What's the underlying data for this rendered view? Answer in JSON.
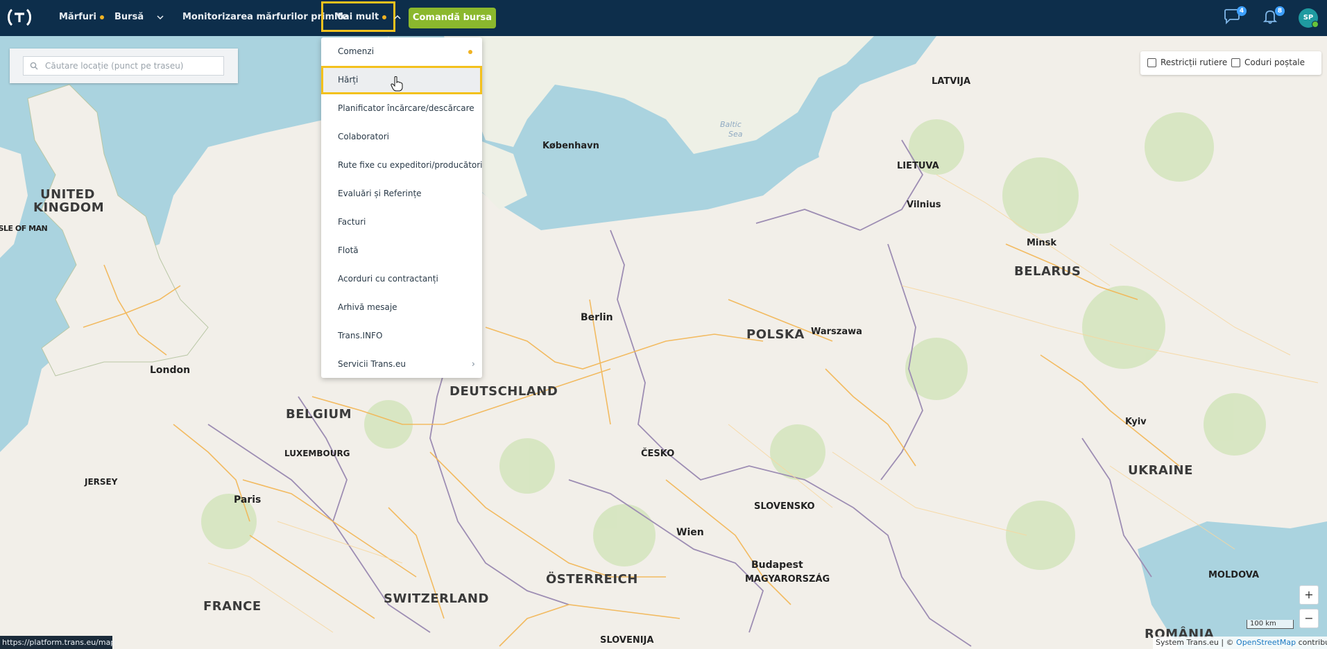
{
  "nav": {
    "items": [
      {
        "label": "Mărfuri"
      },
      {
        "label": "Bursă"
      },
      {
        "label": "Monitorizarea mărfurilor primite"
      },
      {
        "label": "Mai mult"
      }
    ],
    "command_button": "Comandă bursa",
    "messages_count": "4",
    "notifications_count": "8",
    "avatar_initials": "SP"
  },
  "search": {
    "placeholder": "Căutare locație (punct pe traseu)"
  },
  "dropdown": {
    "items": [
      {
        "label": "Comenzi"
      },
      {
        "label": "Hărți"
      },
      {
        "label": "Planificator încărcare/descărcare"
      },
      {
        "label": "Colaboratori"
      },
      {
        "label": "Rute fixe cu expeditori/producători"
      },
      {
        "label": "Evaluări și Referințe"
      },
      {
        "label": "Facturi"
      },
      {
        "label": "Flotă"
      },
      {
        "label": "Acorduri cu contractanți"
      },
      {
        "label": "Arhivă mesaje"
      },
      {
        "label": "Trans.INFO"
      },
      {
        "label": "Servicii Trans.eu"
      }
    ]
  },
  "filters": {
    "road_restrictions": "Restricții rutiere",
    "postal_codes": "Coduri poștale"
  },
  "map": {
    "countries": [
      "UNITED KINGDOM",
      "BELGIUM",
      "LUXEMBOURG",
      "DEUTSCHLAND",
      "POLSKA",
      "BELARUS",
      "UKRAINE",
      "FRANCE",
      "SWITZERLAND",
      "ÖSTERREICH",
      "ČESKO",
      "SLOVENSKO",
      "MAGYARORSZÁG",
      "MOLDOVA",
      "ROMÂNIA",
      "SLOVENIJA",
      "LATVIJA",
      "LIETUVA",
      "JERSEY",
      "ISLE OF MAN"
    ],
    "big_cities": [
      "London",
      "Paris",
      "Berlin",
      "Warszawa",
      "København",
      "Vilnius",
      "Minsk",
      "Kyiv",
      "Wien",
      "Budapest"
    ],
    "sea_label": "Baltic Sea",
    "scale_label": "100 km"
  },
  "attribution": {
    "prefix": "System Trans.eu | ©",
    "link": "OpenStreetMap",
    "suffix": "contributors"
  },
  "status_url": "https://platform.trans.eu/map",
  "colors": {
    "topbar": "#0d2e4b",
    "accent": "#f3c11d",
    "command": "#8bb82d",
    "badge": "#3da0ff"
  }
}
